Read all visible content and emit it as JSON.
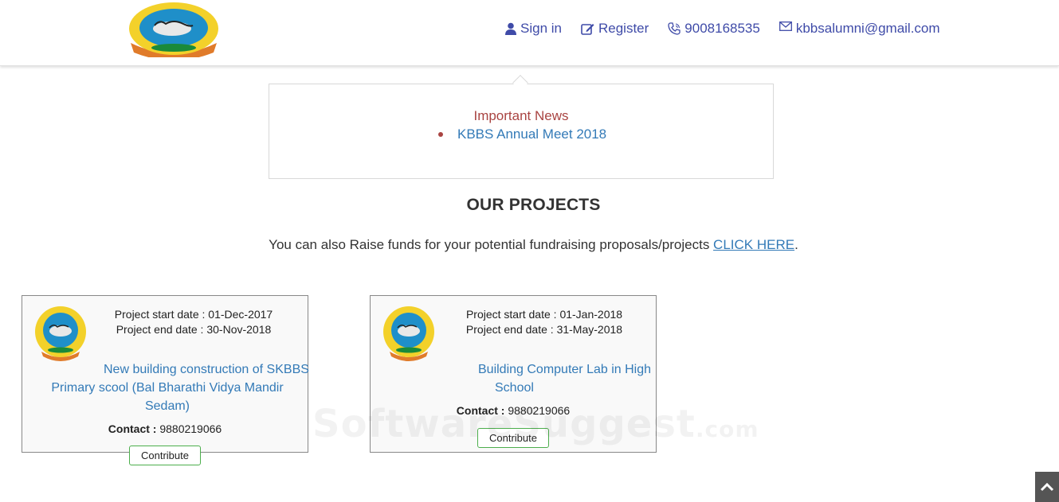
{
  "header": {
    "nav": {
      "signin": "Sign in",
      "register": "Register",
      "phone": "9008168535",
      "email": "kbbsalumni@gmail.com"
    }
  },
  "news": {
    "title": "Important News",
    "items": [
      "KBBS Annual Meet 2018"
    ]
  },
  "projects_section": {
    "title": "OUR PROJECTS",
    "raise_text": "You can also Raise funds for your potential fundraising proposals/projects ",
    "raise_link": "CLICK HERE",
    "raise_end": "."
  },
  "projects": [
    {
      "start_label": "Project start date : ",
      "start": "01-Dec-2017",
      "end_label": "Project end date : ",
      "end": "30-Nov-2018",
      "title_line1": "New building construction of SKBBS",
      "title_line2": "Primary scool (Bal Bharathi Vidya Mandir",
      "title_line3": "Sedam)",
      "contact_label": "Contact : ",
      "contact": "9880219066",
      "button": "Contribute"
    },
    {
      "start_label": "Project start date : ",
      "start": "01-Jan-2018",
      "end_label": "Project end date : ",
      "end": "31-May-2018",
      "title_line1": "Building Computer Lab in High",
      "title_line2": "School",
      "contact_label": "Contact : ",
      "contact": "9880219066",
      "button": "Contribute"
    }
  ],
  "watermark": {
    "main": "SoftwareSuggest",
    "suffix": ".com"
  },
  "colors": {
    "nav": "#3f4ba8",
    "link": "#337ab7",
    "news_title": "#a94442",
    "button_border": "#4cae4c"
  },
  "icons": {
    "signin": "user-icon",
    "register": "edit-icon",
    "phone": "phone-icon",
    "email": "envelope-icon",
    "scroll_top": "chevron-up-icon"
  }
}
